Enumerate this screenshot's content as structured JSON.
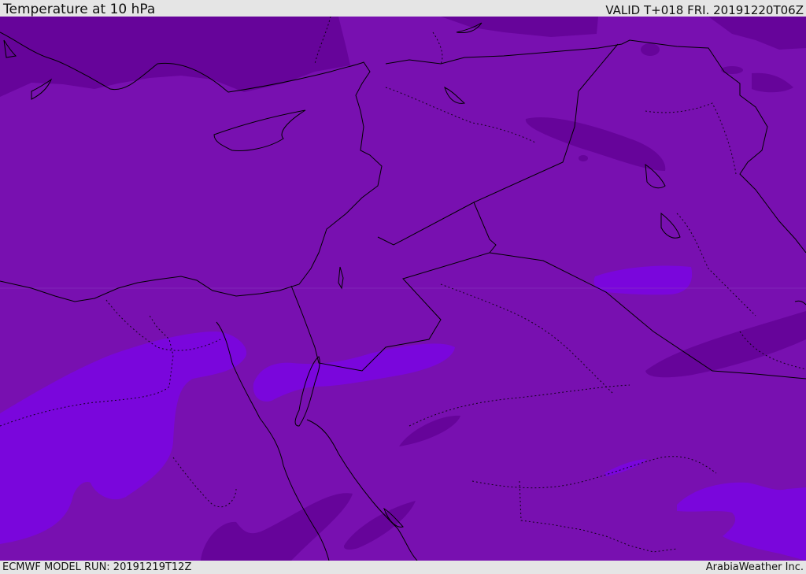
{
  "header": {
    "title": "Temperature at 10 hPa",
    "valid": "VALID T+018 FRI. 20191220T06Z"
  },
  "footer": {
    "model_run": "ECMWF MODEL RUN: 20191219T12Z",
    "credit": "ArabiaWeather Inc."
  },
  "colors": {
    "base_field": "#7810b0",
    "cold_field": "#66049a",
    "warm_field": "#7a06dc",
    "coastline": "#000000",
    "border": "#000000"
  }
}
